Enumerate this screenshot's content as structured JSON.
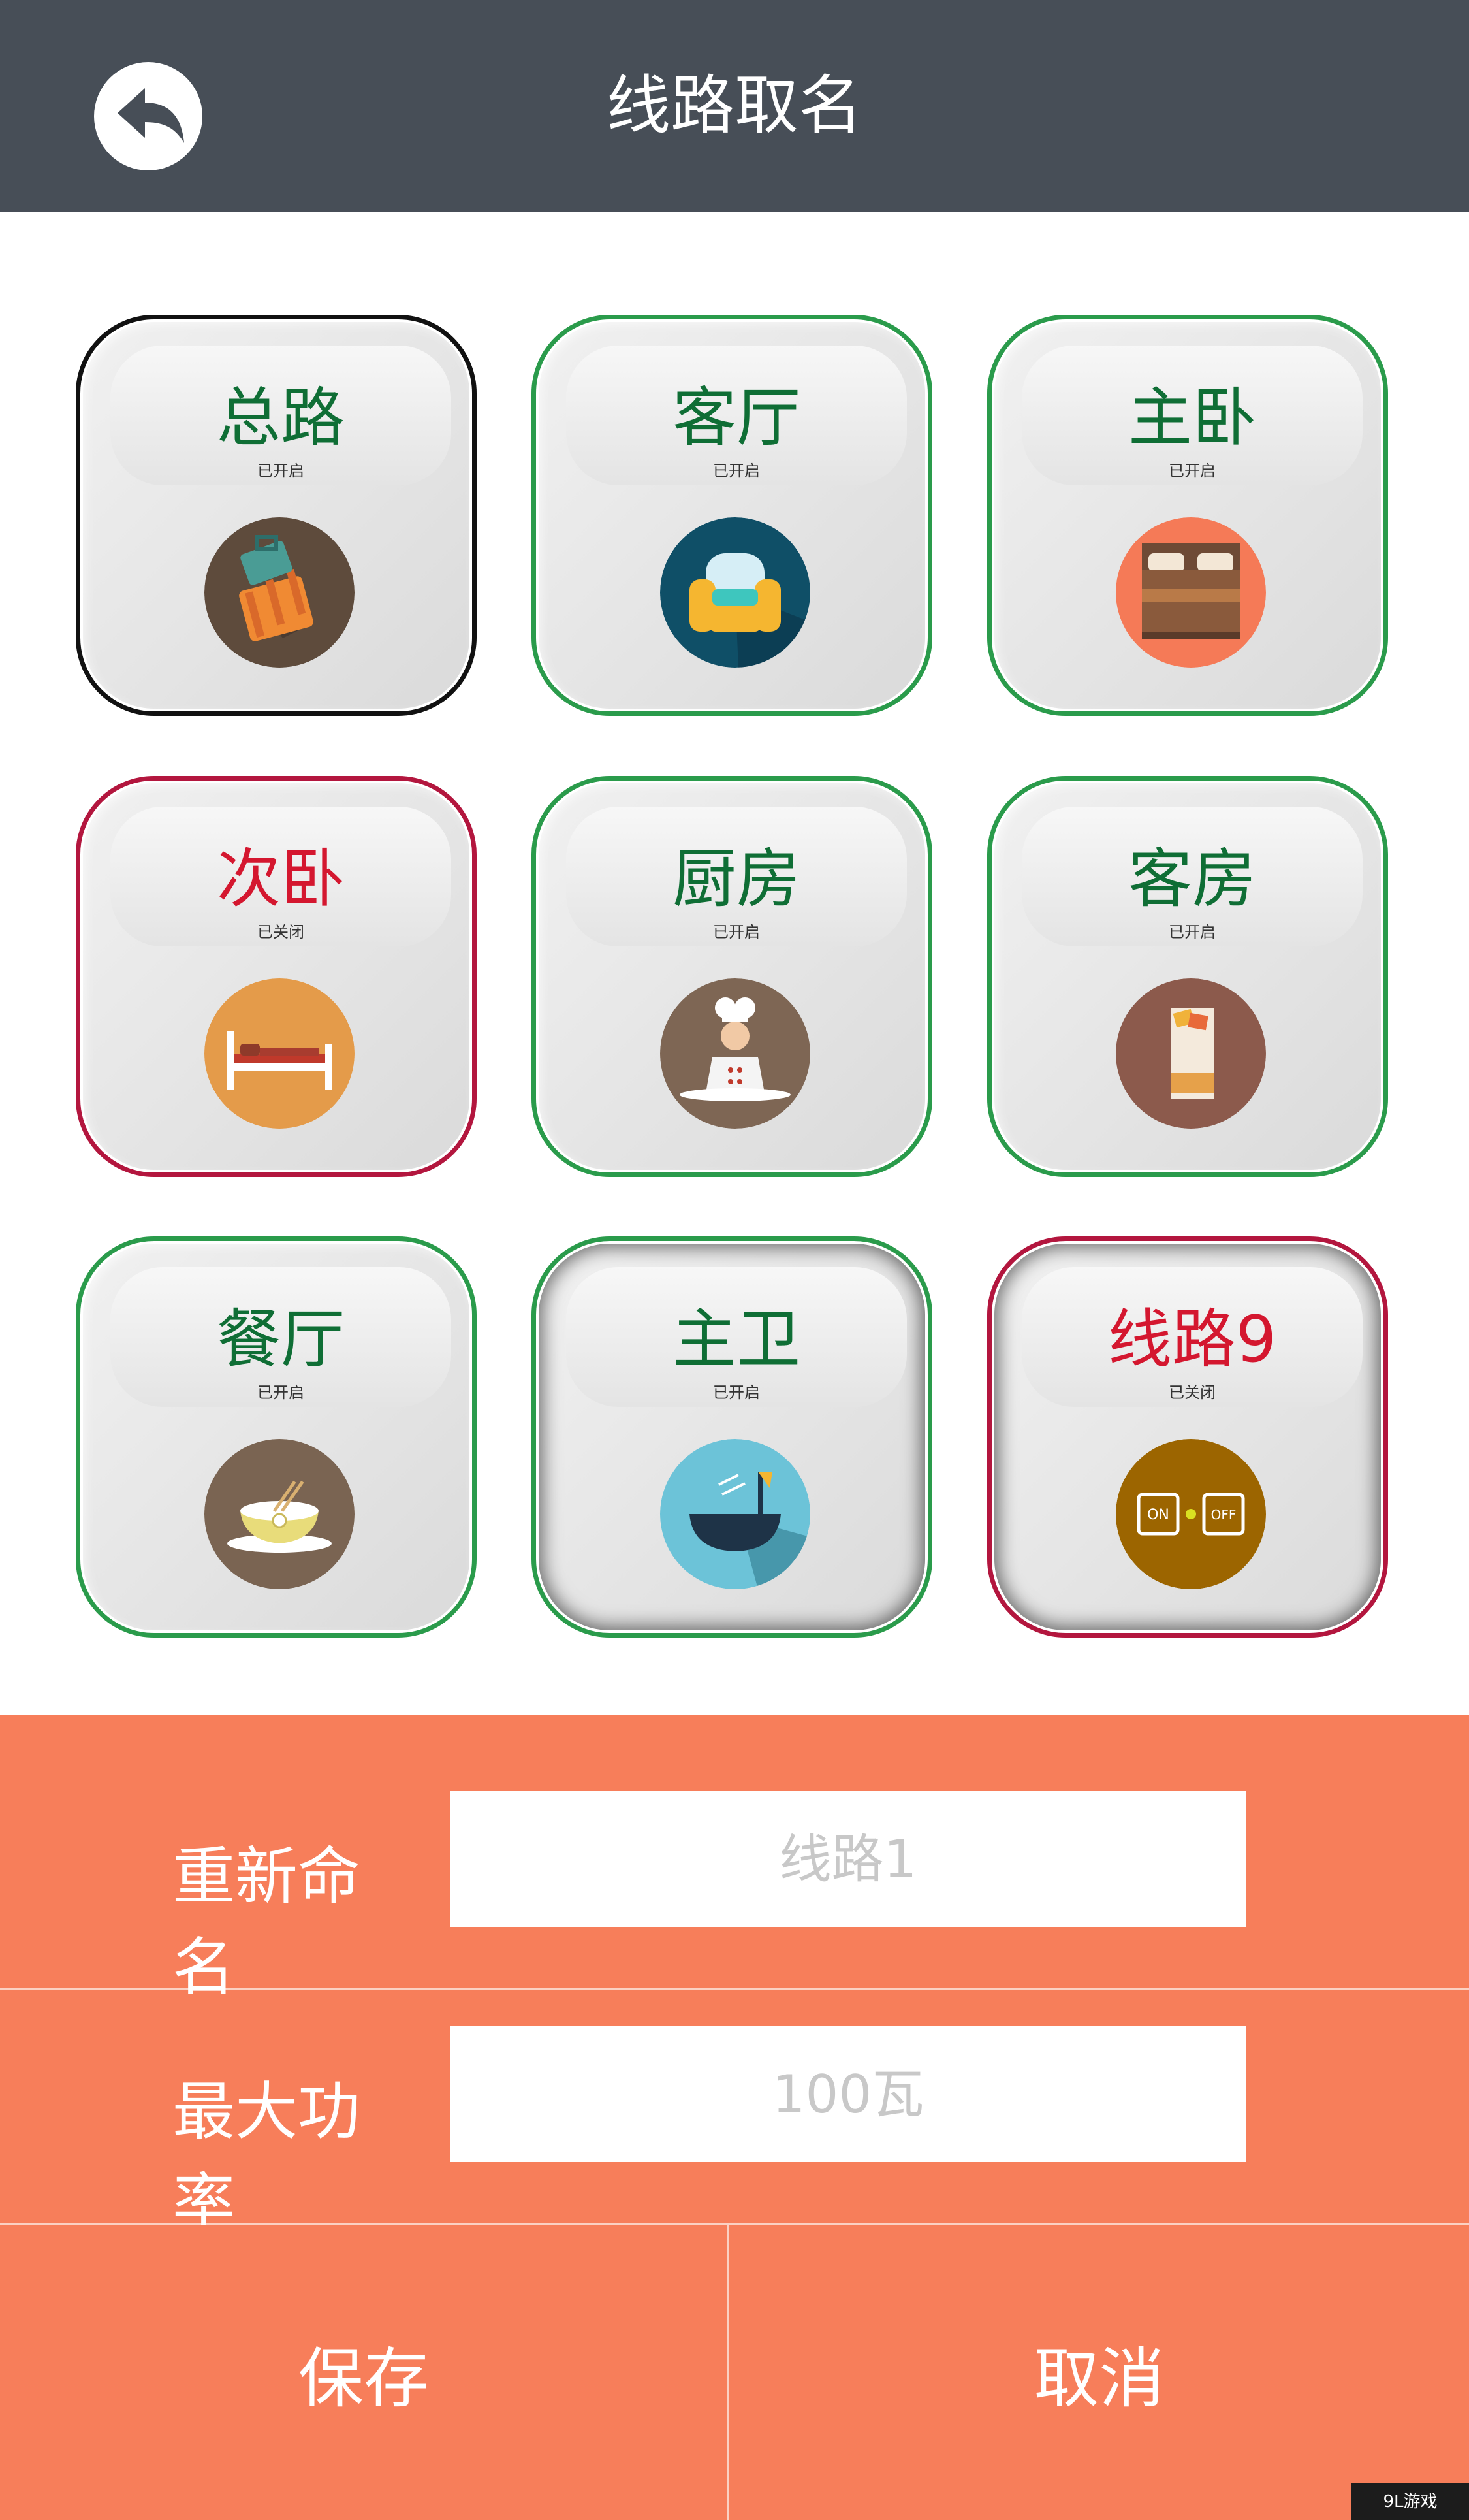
{
  "header": {
    "title": "线路取名",
    "back_icon": "back-arrow-icon"
  },
  "colors": {
    "header_bg": "#474e57",
    "panel_bg": "#f77e5a",
    "on_text": "#0f6e35",
    "off_text": "#d4172f",
    "on_border": "#2a9b4b",
    "off_border": "#b3163e"
  },
  "circuits": [
    {
      "name": "总路",
      "status": "已开启",
      "state": "on",
      "icon": "luggage-icon"
    },
    {
      "name": "客厅",
      "status": "已开启",
      "state": "on",
      "icon": "armchair-icon"
    },
    {
      "name": "主卧",
      "status": "已开启",
      "state": "on",
      "icon": "double-bed-icon"
    },
    {
      "name": "次卧",
      "status": "已关闭",
      "state": "off",
      "icon": "single-bed-icon"
    },
    {
      "name": "厨房",
      "status": "已开启",
      "state": "on",
      "icon": "chef-icon"
    },
    {
      "name": "客房",
      "status": "已开启",
      "state": "on",
      "icon": "guest-bed-icon"
    },
    {
      "name": "餐厅",
      "status": "已开启",
      "state": "on",
      "icon": "rice-bowl-icon"
    },
    {
      "name": "主卫",
      "status": "已开启",
      "state": "on",
      "icon": "bathtub-icon"
    },
    {
      "name": "线路9",
      "status": "已关闭",
      "state": "off",
      "icon": "on-off-switch-icon"
    }
  ],
  "form": {
    "rename_label": "重新命名",
    "rename_placeholder": "线路1",
    "power_label": "最大功率",
    "power_placeholder": "100瓦"
  },
  "actions": {
    "save_label": "保存",
    "cancel_label": "取消"
  },
  "watermark": "9L游戏"
}
